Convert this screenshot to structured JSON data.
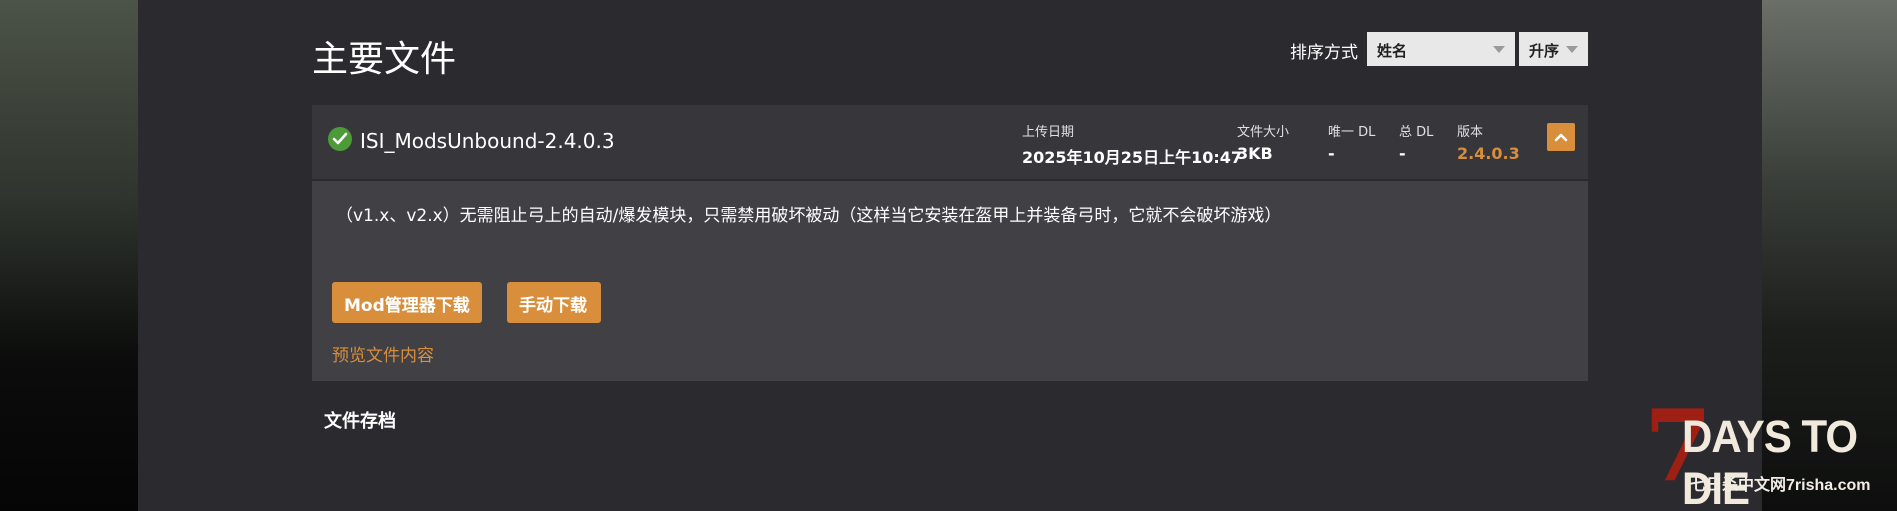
{
  "page": {
    "title": "主要文件"
  },
  "sort": {
    "label": "排序方式",
    "field_value": "姓名",
    "order_value": "升序"
  },
  "file": {
    "name": "ISI_ModsUnbound-2.4.0.3",
    "status_icon": "check-circle-icon",
    "upload_date_label": "上传日期",
    "upload_date_value": "2025年10月25日上午10:47",
    "size_label": "文件大小",
    "size_value": "3KB",
    "unique_dl_label": "唯一 DL",
    "unique_dl_value": "-",
    "total_dl_label": "总 DL",
    "total_dl_value": "-",
    "version_label": "版本",
    "version_value": "2.4.0.3",
    "description": "（v1.x、v2.x）无需阻止弓上的自动/爆发模块，只需禁用破坏被动（这样当它安装在盔甲上并装备弓时，它就不会破坏游戏）",
    "mod_manager_button": "Mod管理器下载",
    "manual_button": "手动下载",
    "preview_link": "预览文件内容"
  },
  "archive": {
    "title": "文件存档"
  },
  "watermark": {
    "logo_numeral": "7",
    "logo_text": "DAYS TO DIE",
    "logo_sub": "七日杀中文网7risha.com"
  },
  "colors": {
    "accent": "#d98e3b",
    "panel_bg": "#2b2a2e",
    "file_header_bg": "#37363b",
    "file_body_bg": "#404045",
    "success": "#4d9a39",
    "logo_red": "#9e1f14"
  }
}
